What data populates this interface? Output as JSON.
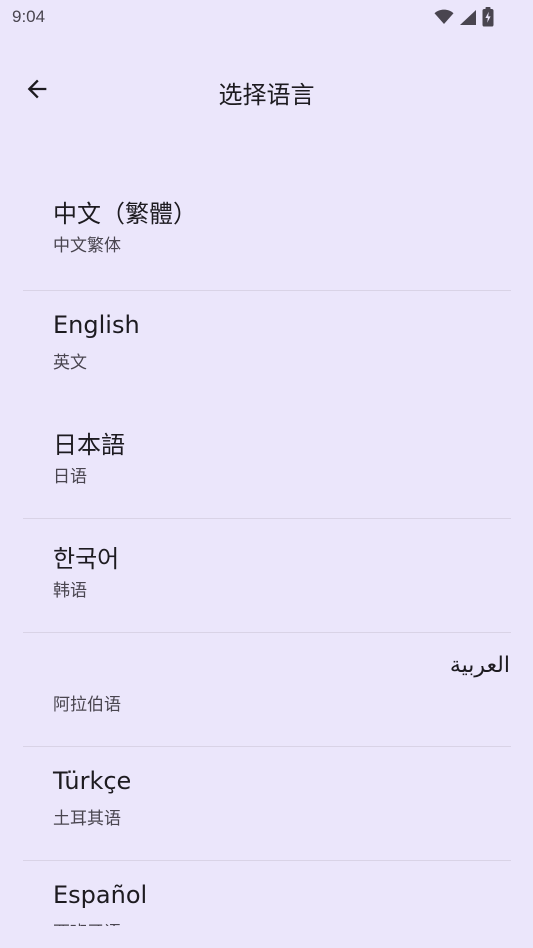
{
  "status_bar": {
    "time": "9:04",
    "icons": [
      "wifi-icon",
      "cell-signal-icon",
      "battery-charging-icon"
    ]
  },
  "app_bar": {
    "back_icon": "arrow-left-icon",
    "title": "选择语言"
  },
  "languages": [
    {
      "name": "中文（繁體）",
      "subtitle": "中文繁体"
    },
    {
      "name": "English",
      "subtitle": "英文"
    },
    {
      "name": "日本語",
      "subtitle": "日语"
    },
    {
      "name": "한국어",
      "subtitle": "韩语"
    },
    {
      "name": "العربية",
      "subtitle": "阿拉伯语"
    },
    {
      "name": "Türkçe",
      "subtitle": "土耳其语"
    },
    {
      "name": "Español",
      "subtitle": "西班牙语"
    }
  ],
  "colors": {
    "background": "#ebe6fb",
    "text_primary": "#1d1b20",
    "text_secondary": "#49454f",
    "divider": "#d9d3e6"
  }
}
